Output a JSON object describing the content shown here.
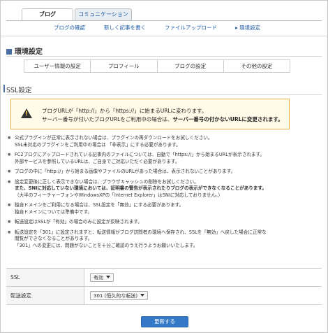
{
  "tabs": [
    {
      "label": "ブログ"
    },
    {
      "label": "コミュニケーション"
    }
  ],
  "subnav": [
    {
      "label": "ブログの確認"
    },
    {
      "label": "新しく記事を書く"
    },
    {
      "label": "ファイルアップロード"
    },
    {
      "label": "環境設定"
    }
  ],
  "page_title": "環境設定",
  "settings_tabs": [
    {
      "label": "ユーザー情報の設定"
    },
    {
      "label": "プロフィール"
    },
    {
      "label": "ブログの設定"
    },
    {
      "label": "その他の設定"
    }
  ],
  "section_title": "SSL設定",
  "warning": {
    "line1": "ブログURLが「http://」から「https://」に始まるURLに変わります。",
    "line2_prefix": "サーバー番号が付いたブログURLをご利用中の場合は、",
    "line2_bold": "サーバー番号の付かないURLに変更されます。"
  },
  "notes": [
    [
      "公式プラグインが正常に表示されない場合は、プラグインの再ダウンロードをお試しください。",
      "SSL未対応のプラグインをご利用中の場合は 「非表示」にする必要があります。"
    ],
    [
      "FC2ブログにアップロードされている記事内のファイルについては、自動で「https://」から始まるURLが表示されます。",
      "外部サービスを参照しているURLは、ご自身でご対応いただく必要があります。"
    ],
    [
      "ブログの中に「http://」から始まる画像やファイルのURLがあった場合は、表示されないことがあります。"
    ],
    [
      "設定変更後に正しく表示できない場合は、ブラウザキャッシュの削除をお試しください。",
      "また、SNIに対応していない環境においては、証明書の警告が表示されたりブログの表示ができなくなることがあります。",
      "（大半のフィーチャーフォンやWindowsXPの「Internet Explorer」はSNIに対応しておりません。）"
    ],
    [
      "独自ドメインをご利用になる場合は、SSL設定を「無効」にする必要があります。",
      "独自ドメインについては準備中です。"
    ],
    [
      "転送設定はSSLが「有効」の場合のみに設定が反映されます。"
    ],
    [
      "転送設定を「301」に設定されますと、転送情報がブログ訪問者の環境へ保存され、SSLを「無効」へ戻した場合に正常な",
      "閲覧ができなくなることがあります。",
      "「301」への変更には、問題がないことを十分ご確認のうえ行うようお願いいたします。"
    ]
  ],
  "form": {
    "ssl_label": "SSL",
    "ssl_value": "有効",
    "redirect_label": "転送設定",
    "redirect_value": "301 (恒久的な転送)"
  },
  "submit_label": "更新する",
  "colors": {
    "accent": "#3478c8",
    "link": "#1a5aa6",
    "warning_border": "#f0b040"
  }
}
